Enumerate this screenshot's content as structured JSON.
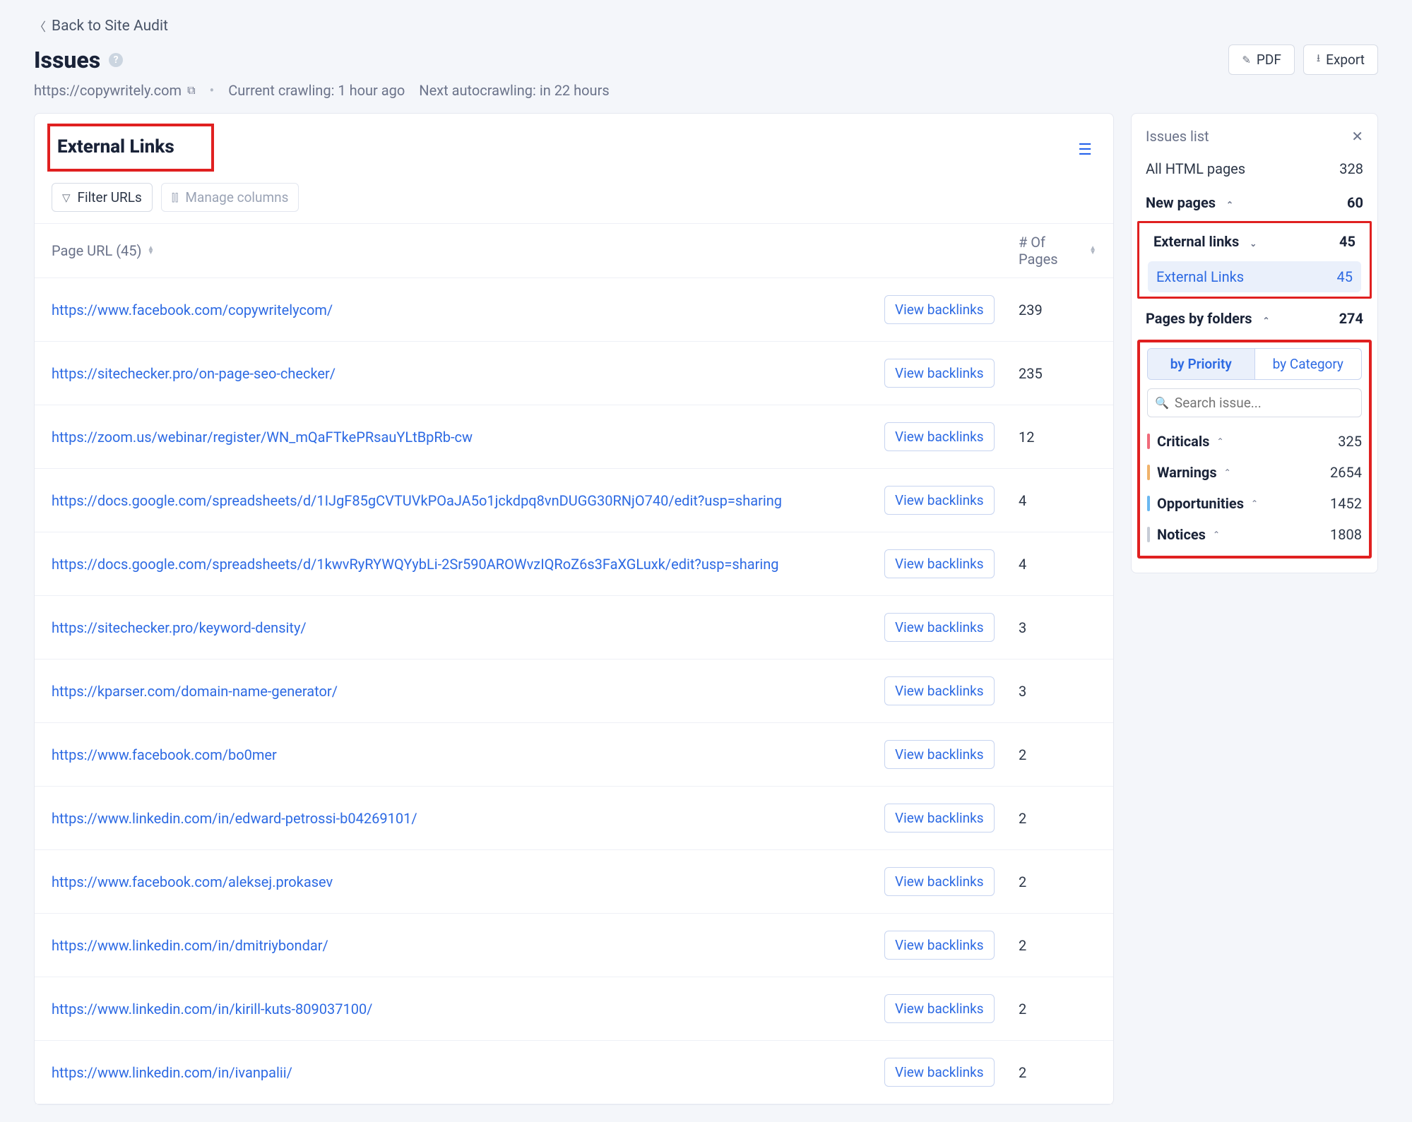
{
  "header": {
    "back_label": "Back to Site Audit",
    "title": "Issues",
    "pdf_label": "PDF",
    "export_label": "Export",
    "site_url": "https://copywritely.com",
    "crawl_status": "Current crawling: 1 hour ago",
    "next_crawl": "Next autocrawling: in 22 hours"
  },
  "section": {
    "title": "External Links",
    "filter_label": "Filter URLs",
    "manage_cols_label": "Manage columns",
    "col_url": "Page URL (45)",
    "col_pages": "# Of Pages",
    "view_backlinks_label": "View backlinks"
  },
  "rows": [
    {
      "url": "https://www.facebook.com/copywritelycom/",
      "pages": "239"
    },
    {
      "url": "https://sitechecker.pro/on-page-seo-checker/",
      "pages": "235"
    },
    {
      "url": "https://zoom.us/webinar/register/WN_mQaFTkePRsauYLtBpRb-cw",
      "pages": "12"
    },
    {
      "url": "https://docs.google.com/spreadsheets/d/1IJgF85gCVTUVkPOaJA5o1jckdpq8vnDUGG30RNjO740/edit?usp=sharing",
      "pages": "4"
    },
    {
      "url": "https://docs.google.com/spreadsheets/d/1kwvRyRYWQYybLi-2Sr590AROWvzIQRoZ6s3FaXGLuxk/edit?usp=sharing",
      "pages": "4"
    },
    {
      "url": "https://sitechecker.pro/keyword-density/",
      "pages": "3"
    },
    {
      "url": "https://kparser.com/domain-name-generator/",
      "pages": "3"
    },
    {
      "url": "https://www.facebook.com/bo0mer",
      "pages": "2"
    },
    {
      "url": "https://www.linkedin.com/in/edward-petrossi-b04269101/",
      "pages": "2"
    },
    {
      "url": "https://www.facebook.com/aleksej.prokasev",
      "pages": "2"
    },
    {
      "url": "https://www.linkedin.com/in/dmitriybondar/",
      "pages": "2"
    },
    {
      "url": "https://www.linkedin.com/in/kirill-kuts-809037100/",
      "pages": "2"
    },
    {
      "url": "https://www.linkedin.com/in/ivanpalii/",
      "pages": "2"
    }
  ],
  "sidebar": {
    "title": "Issues list",
    "all_html_label": "All HTML pages",
    "all_html_count": "328",
    "new_pages_label": "New pages",
    "new_pages_count": "60",
    "ext_links_label": "External links",
    "ext_links_count": "45",
    "ext_links_sub_label": "External Links",
    "ext_links_sub_count": "45",
    "folders_label": "Pages by folders",
    "folders_count": "274",
    "tab_priority": "by Priority",
    "tab_category": "by Category",
    "search_placeholder": "Search issue...",
    "severities": [
      {
        "name": "Criticals",
        "count": "325",
        "color": "#f06a7a"
      },
      {
        "name": "Warnings",
        "count": "2654",
        "color": "#f0b26a"
      },
      {
        "name": "Opportunities",
        "count": "1452",
        "color": "#6ab7f0"
      },
      {
        "name": "Notices",
        "count": "1808",
        "color": "#c7ccd6"
      }
    ]
  }
}
